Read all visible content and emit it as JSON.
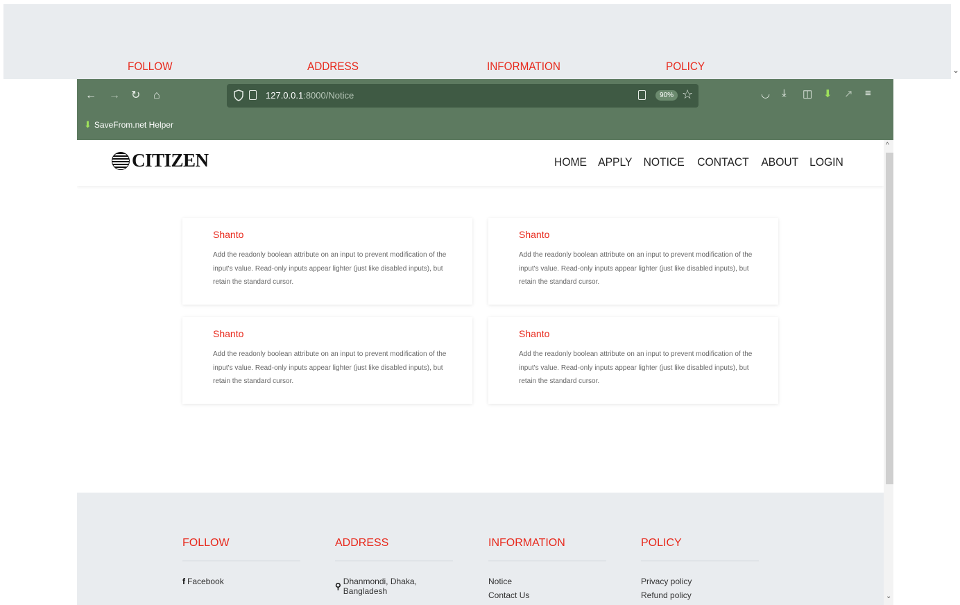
{
  "outer_footer": {
    "headings": [
      "FOLLOW",
      "ADDRESS",
      "INFORMATION",
      "POLICY"
    ]
  },
  "browser": {
    "url_host": "127.0.0.1",
    "url_path": ":8000/Notice",
    "zoom": "90%",
    "bookmark_label": "SaveFrom.net Helper"
  },
  "site": {
    "logo_text": "CITIZEN",
    "nav": [
      "HOME",
      "APPLY",
      "NOTICE",
      "CONTACT",
      "ABOUT",
      "LOGIN"
    ]
  },
  "notices": [
    {
      "title": "Shanto",
      "body": "Add the readonly boolean attribute on an input to prevent modification of the input's value. Read-only inputs appear lighter (just like disabled inputs), but retain the standard cursor."
    },
    {
      "title": "Shanto",
      "body": "Add the readonly boolean attribute on an input to prevent modification of the input's value. Read-only inputs appear lighter (just like disabled inputs), but retain the standard cursor."
    },
    {
      "title": "Shanto",
      "body": "Add the readonly boolean attribute on an input to prevent modification of the input's value. Read-only inputs appear lighter (just like disabled inputs), but retain the standard cursor."
    },
    {
      "title": "Shanto",
      "body": "Add the readonly boolean attribute on an input to prevent modification of the input's value. Read-only inputs appear lighter (just like disabled inputs), but retain the standard cursor."
    }
  ],
  "footer": {
    "follow": {
      "heading": "FOLLOW",
      "items": [
        "Facebook"
      ]
    },
    "address": {
      "heading": "ADDRESS",
      "items": [
        "Dhanmondi, Dhaka, Bangladesh"
      ]
    },
    "information": {
      "heading": "INFORMATION",
      "items": [
        "Notice",
        "Contact Us"
      ]
    },
    "policy": {
      "heading": "POLICY",
      "items": [
        "Privacy policy",
        "Refund policy"
      ]
    }
  },
  "colors": {
    "accent": "#e8291c",
    "toolbar": "#5d7a60",
    "footer_bg": "#e9ecef"
  }
}
